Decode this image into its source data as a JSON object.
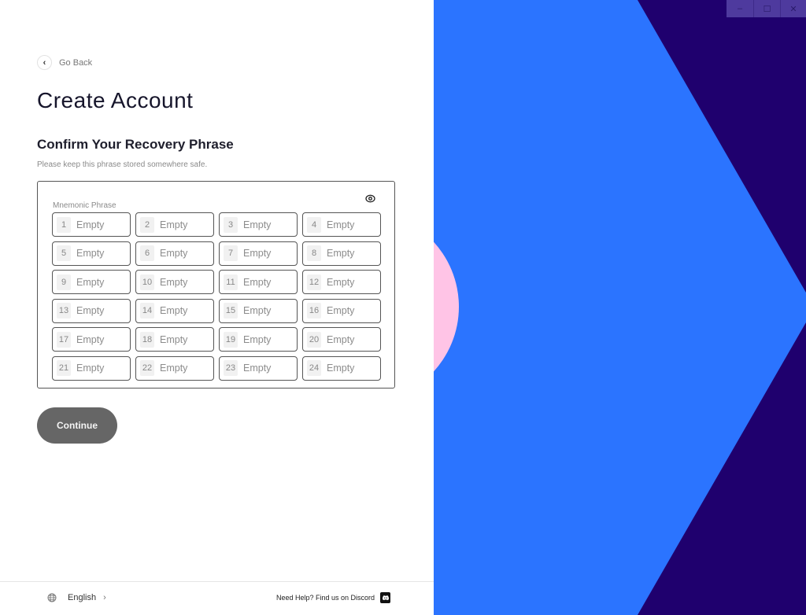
{
  "window": {
    "controls": {
      "minimize": "–",
      "maximize": "☐",
      "close": "✕"
    }
  },
  "nav": {
    "back_icon": "‹",
    "back_label": "Go Back"
  },
  "page": {
    "title": "Create Account",
    "subtitle": "Confirm Your Recovery Phrase",
    "hint": "Please keep this phrase stored somewhere safe."
  },
  "phrase": {
    "label": "Mnemonic Phrase",
    "toggle_icon": "eye-icon",
    "words": [
      {
        "index": "1",
        "placeholder": "Empty",
        "value": ""
      },
      {
        "index": "2",
        "placeholder": "Empty",
        "value": ""
      },
      {
        "index": "3",
        "placeholder": "Empty",
        "value": ""
      },
      {
        "index": "4",
        "placeholder": "Empty",
        "value": ""
      },
      {
        "index": "5",
        "placeholder": "Empty",
        "value": ""
      },
      {
        "index": "6",
        "placeholder": "Empty",
        "value": ""
      },
      {
        "index": "7",
        "placeholder": "Empty",
        "value": ""
      },
      {
        "index": "8",
        "placeholder": "Empty",
        "value": ""
      },
      {
        "index": "9",
        "placeholder": "Empty",
        "value": ""
      },
      {
        "index": "10",
        "placeholder": "Empty",
        "value": ""
      },
      {
        "index": "11",
        "placeholder": "Empty",
        "value": ""
      },
      {
        "index": "12",
        "placeholder": "Empty",
        "value": ""
      },
      {
        "index": "13",
        "placeholder": "Empty",
        "value": ""
      },
      {
        "index": "14",
        "placeholder": "Empty",
        "value": ""
      },
      {
        "index": "15",
        "placeholder": "Empty",
        "value": ""
      },
      {
        "index": "16",
        "placeholder": "Empty",
        "value": ""
      },
      {
        "index": "17",
        "placeholder": "Empty",
        "value": ""
      },
      {
        "index": "18",
        "placeholder": "Empty",
        "value": ""
      },
      {
        "index": "19",
        "placeholder": "Empty",
        "value": ""
      },
      {
        "index": "20",
        "placeholder": "Empty",
        "value": ""
      },
      {
        "index": "21",
        "placeholder": "Empty",
        "value": ""
      },
      {
        "index": "22",
        "placeholder": "Empty",
        "value": ""
      },
      {
        "index": "23",
        "placeholder": "Empty",
        "value": ""
      },
      {
        "index": "24",
        "placeholder": "Empty",
        "value": ""
      }
    ]
  },
  "actions": {
    "continue_label": "Continue"
  },
  "footer": {
    "language": "English",
    "language_chevron": "›",
    "help_text": "Need Help? Find us on Discord"
  },
  "colors": {
    "art_blue": "#2b74ff",
    "art_navy": "#1f006e",
    "art_pink": "#ffc4e6",
    "button_gray": "#666666"
  }
}
